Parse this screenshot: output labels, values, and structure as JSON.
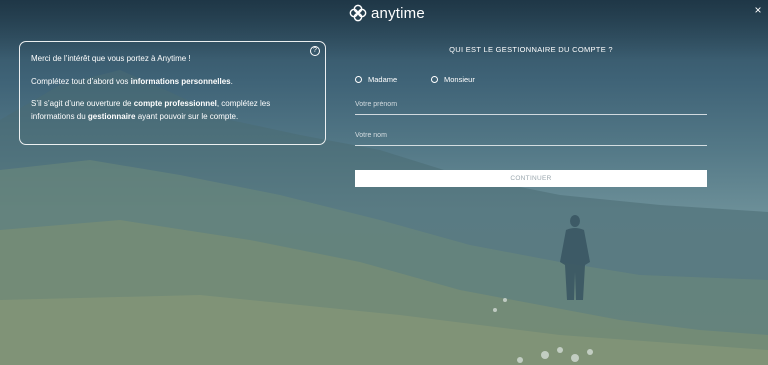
{
  "header": {
    "logo_text": "anytime",
    "close_label": "×"
  },
  "info": {
    "help_label": "?",
    "line1": "Merci de l’intérêt que vous portez à Anytime !",
    "line2_pre": "Complétez tout d’abord vos ",
    "line2_bold": "informations personnelles",
    "line2_post": ".",
    "line3_pre": "S’il s’agit d’une ouverture de ",
    "line3_bold1": "compte professionnel",
    "line3_mid1": ", complétez les informations du ",
    "line3_bold2": "gestionnaire",
    "line3_post": " ayant pouvoir sur le compte."
  },
  "form": {
    "title": "QUI EST LE GESTIONNAIRE DU COMPTE ?",
    "radio_madame": "Madame",
    "radio_monsieur": "Monsieur",
    "first_name_placeholder": "Votre prénom",
    "last_name_placeholder": "Votre nom",
    "continue_label": "CONTINUER"
  }
}
